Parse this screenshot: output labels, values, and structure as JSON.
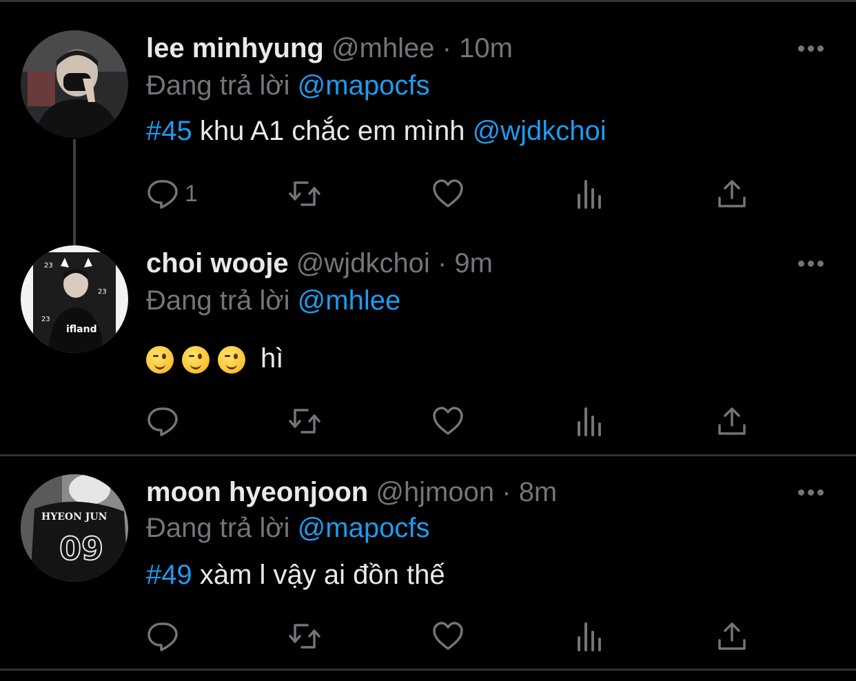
{
  "tweets": [
    {
      "name": "lee minhyung",
      "handle": "@mhlee",
      "separator": "·",
      "time": "10m",
      "replying_prefix": "Đang trả lời",
      "replying_to": "@mapocfs",
      "hashtag": "#45",
      "text": " khu A1 chắc em mình ",
      "mention": "@wjdkchoi",
      "reply_count": "1"
    },
    {
      "name": "choi wooje",
      "handle": "@wjdkchoi",
      "separator": "·",
      "time": "9m",
      "replying_prefix": "Đang trả lời",
      "replying_to": "@mhlee",
      "emoji_name": "winking-face",
      "emoji_count": 3,
      "text": "hì",
      "reply_count": ""
    },
    {
      "name": "moon hyeonjoon",
      "handle": "@hjmoon",
      "separator": "·",
      "time": "8m",
      "replying_prefix": "Đang trả lời",
      "replying_to": "@mapocfs",
      "hashtag": "#49",
      "text": " xàm l vậy ai đồn thế",
      "reply_count": "",
      "avatar_jersey_name": "HYEON JUN",
      "avatar_jersey_number": "09"
    }
  ],
  "icons": {
    "reply": "reply-icon",
    "retweet": "retweet-icon",
    "like": "heart-icon",
    "views": "views-icon",
    "share": "share-icon",
    "more": "more-icon"
  },
  "colors": {
    "background": "#000000",
    "text": "#e7e9ea",
    "muted": "#71767b",
    "accent": "#1d9bf0",
    "divider": "#2f3336"
  }
}
